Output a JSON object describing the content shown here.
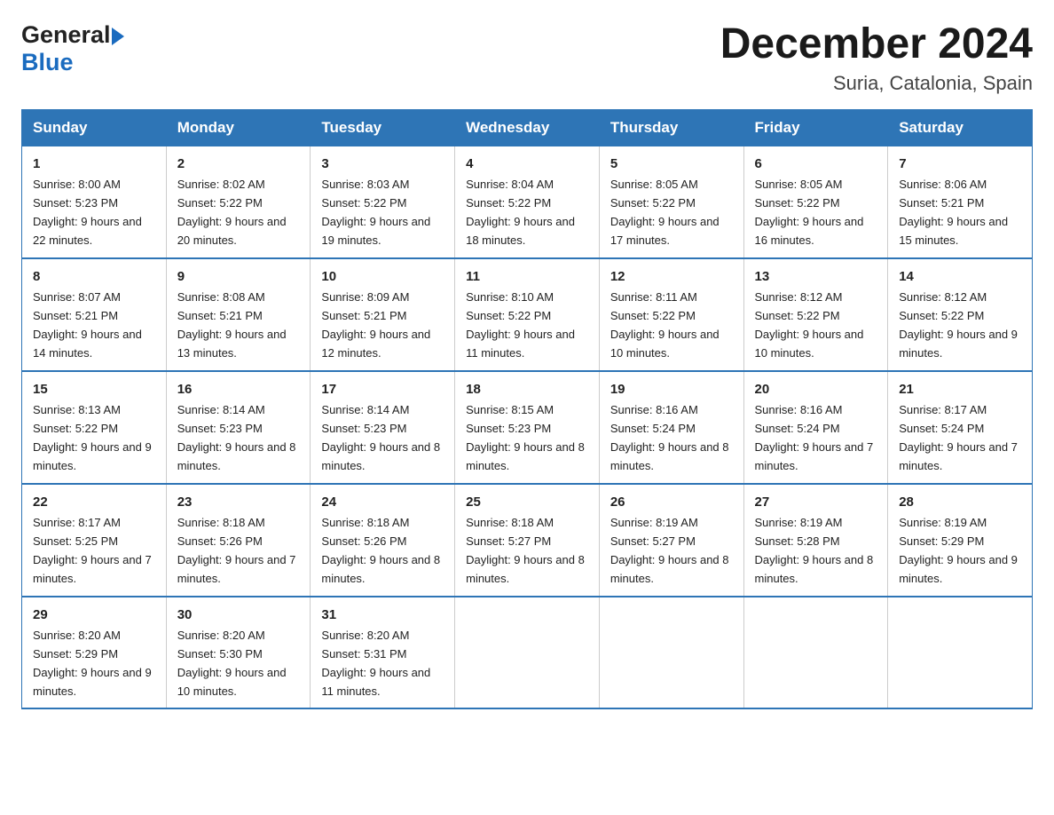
{
  "logo": {
    "general": "General",
    "blue": "Blue"
  },
  "title": "December 2024",
  "location": "Suria, Catalonia, Spain",
  "days_of_week": [
    "Sunday",
    "Monday",
    "Tuesday",
    "Wednesday",
    "Thursday",
    "Friday",
    "Saturday"
  ],
  "weeks": [
    [
      {
        "day": "1",
        "sunrise": "8:00 AM",
        "sunset": "5:23 PM",
        "daylight": "9 hours and 22 minutes."
      },
      {
        "day": "2",
        "sunrise": "8:02 AM",
        "sunset": "5:22 PM",
        "daylight": "9 hours and 20 minutes."
      },
      {
        "day": "3",
        "sunrise": "8:03 AM",
        "sunset": "5:22 PM",
        "daylight": "9 hours and 19 minutes."
      },
      {
        "day": "4",
        "sunrise": "8:04 AM",
        "sunset": "5:22 PM",
        "daylight": "9 hours and 18 minutes."
      },
      {
        "day": "5",
        "sunrise": "8:05 AM",
        "sunset": "5:22 PM",
        "daylight": "9 hours and 17 minutes."
      },
      {
        "day": "6",
        "sunrise": "8:05 AM",
        "sunset": "5:22 PM",
        "daylight": "9 hours and 16 minutes."
      },
      {
        "day": "7",
        "sunrise": "8:06 AM",
        "sunset": "5:21 PM",
        "daylight": "9 hours and 15 minutes."
      }
    ],
    [
      {
        "day": "8",
        "sunrise": "8:07 AM",
        "sunset": "5:21 PM",
        "daylight": "9 hours and 14 minutes."
      },
      {
        "day": "9",
        "sunrise": "8:08 AM",
        "sunset": "5:21 PM",
        "daylight": "9 hours and 13 minutes."
      },
      {
        "day": "10",
        "sunrise": "8:09 AM",
        "sunset": "5:21 PM",
        "daylight": "9 hours and 12 minutes."
      },
      {
        "day": "11",
        "sunrise": "8:10 AM",
        "sunset": "5:22 PM",
        "daylight": "9 hours and 11 minutes."
      },
      {
        "day": "12",
        "sunrise": "8:11 AM",
        "sunset": "5:22 PM",
        "daylight": "9 hours and 10 minutes."
      },
      {
        "day": "13",
        "sunrise": "8:12 AM",
        "sunset": "5:22 PM",
        "daylight": "9 hours and 10 minutes."
      },
      {
        "day": "14",
        "sunrise": "8:12 AM",
        "sunset": "5:22 PM",
        "daylight": "9 hours and 9 minutes."
      }
    ],
    [
      {
        "day": "15",
        "sunrise": "8:13 AM",
        "sunset": "5:22 PM",
        "daylight": "9 hours and 9 minutes."
      },
      {
        "day": "16",
        "sunrise": "8:14 AM",
        "sunset": "5:23 PM",
        "daylight": "9 hours and 8 minutes."
      },
      {
        "day": "17",
        "sunrise": "8:14 AM",
        "sunset": "5:23 PM",
        "daylight": "9 hours and 8 minutes."
      },
      {
        "day": "18",
        "sunrise": "8:15 AM",
        "sunset": "5:23 PM",
        "daylight": "9 hours and 8 minutes."
      },
      {
        "day": "19",
        "sunrise": "8:16 AM",
        "sunset": "5:24 PM",
        "daylight": "9 hours and 8 minutes."
      },
      {
        "day": "20",
        "sunrise": "8:16 AM",
        "sunset": "5:24 PM",
        "daylight": "9 hours and 7 minutes."
      },
      {
        "day": "21",
        "sunrise": "8:17 AM",
        "sunset": "5:24 PM",
        "daylight": "9 hours and 7 minutes."
      }
    ],
    [
      {
        "day": "22",
        "sunrise": "8:17 AM",
        "sunset": "5:25 PM",
        "daylight": "9 hours and 7 minutes."
      },
      {
        "day": "23",
        "sunrise": "8:18 AM",
        "sunset": "5:26 PM",
        "daylight": "9 hours and 7 minutes."
      },
      {
        "day": "24",
        "sunrise": "8:18 AM",
        "sunset": "5:26 PM",
        "daylight": "9 hours and 8 minutes."
      },
      {
        "day": "25",
        "sunrise": "8:18 AM",
        "sunset": "5:27 PM",
        "daylight": "9 hours and 8 minutes."
      },
      {
        "day": "26",
        "sunrise": "8:19 AM",
        "sunset": "5:27 PM",
        "daylight": "9 hours and 8 minutes."
      },
      {
        "day": "27",
        "sunrise": "8:19 AM",
        "sunset": "5:28 PM",
        "daylight": "9 hours and 8 minutes."
      },
      {
        "day": "28",
        "sunrise": "8:19 AM",
        "sunset": "5:29 PM",
        "daylight": "9 hours and 9 minutes."
      }
    ],
    [
      {
        "day": "29",
        "sunrise": "8:20 AM",
        "sunset": "5:29 PM",
        "daylight": "9 hours and 9 minutes."
      },
      {
        "day": "30",
        "sunrise": "8:20 AM",
        "sunset": "5:30 PM",
        "daylight": "9 hours and 10 minutes."
      },
      {
        "day": "31",
        "sunrise": "8:20 AM",
        "sunset": "5:31 PM",
        "daylight": "9 hours and 11 minutes."
      },
      null,
      null,
      null,
      null
    ]
  ]
}
